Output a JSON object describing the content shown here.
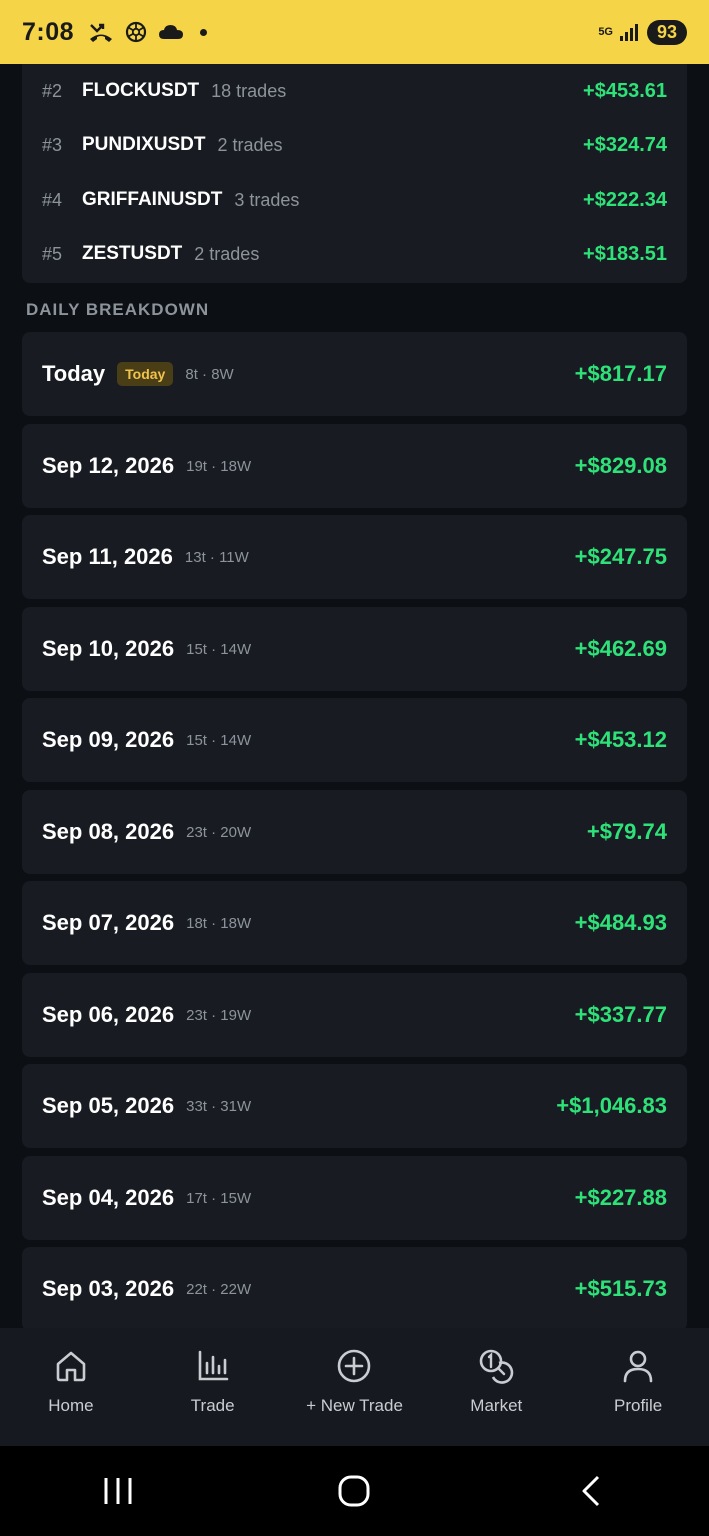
{
  "status_bar": {
    "time": "7:08",
    "network": "5G",
    "battery": "93",
    "icons": [
      "missed-call-icon",
      "openai-icon",
      "cloud-icon",
      "dot-icon",
      "signal-icon"
    ]
  },
  "top_symbols": [
    {
      "rank": "#2",
      "symbol": "FLOCKUSDT",
      "trades": "18 trades",
      "pnl": "+$453.61"
    },
    {
      "rank": "#3",
      "symbol": "PUNDIXUSDT",
      "trades": "2 trades",
      "pnl": "+$324.74"
    },
    {
      "rank": "#4",
      "symbol": "GRIFFAINUSDT",
      "trades": "3 trades",
      "pnl": "+$222.34"
    },
    {
      "rank": "#5",
      "symbol": "ZESTUSDT",
      "trades": "2 trades",
      "pnl": "+$183.51"
    }
  ],
  "daily_breakdown": {
    "header": "DAILY BREAKDOWN",
    "days": [
      {
        "date": "Today",
        "badge": "Today",
        "stats": "8t · 8W",
        "pnl": "+$817.17"
      },
      {
        "date": "Sep 12, 2026",
        "stats": "19t · 18W",
        "pnl": "+$829.08"
      },
      {
        "date": "Sep 11, 2026",
        "stats": "13t · 11W",
        "pnl": "+$247.75"
      },
      {
        "date": "Sep 10, 2026",
        "stats": "15t · 14W",
        "pnl": "+$462.69"
      },
      {
        "date": "Sep 09, 2026",
        "stats": "15t · 14W",
        "pnl": "+$453.12"
      },
      {
        "date": "Sep 08, 2026",
        "stats": "23t · 20W",
        "pnl": "+$79.74"
      },
      {
        "date": "Sep 07, 2026",
        "stats": "18t · 18W",
        "pnl": "+$484.93"
      },
      {
        "date": "Sep 06, 2026",
        "stats": "23t · 19W",
        "pnl": "+$337.77"
      },
      {
        "date": "Sep 05, 2026",
        "stats": "33t · 31W",
        "pnl": "+$1,046.83"
      },
      {
        "date": "Sep 04, 2026",
        "stats": "17t · 15W",
        "pnl": "+$227.88"
      },
      {
        "date": "Sep 03, 2026",
        "stats": "22t · 22W",
        "pnl": "+$515.73"
      }
    ]
  },
  "bottom_nav": [
    {
      "label": "Home",
      "icon": "home-icon"
    },
    {
      "label": "Trade",
      "icon": "chart-bars-icon"
    },
    {
      "label": "+ New Trade",
      "icon": "plus-circle-icon"
    },
    {
      "label": "Market",
      "icon": "coins-icon"
    },
    {
      "label": "Profile",
      "icon": "user-icon"
    }
  ],
  "system_nav": [
    "recent-apps-icon",
    "home-button-icon",
    "back-icon"
  ],
  "colors": {
    "status_bar_bg": "#f5d547",
    "background": "#0c0f13",
    "card": "#181c22",
    "profit_green": "#2ee279",
    "badge_text": "#f0c34d"
  }
}
